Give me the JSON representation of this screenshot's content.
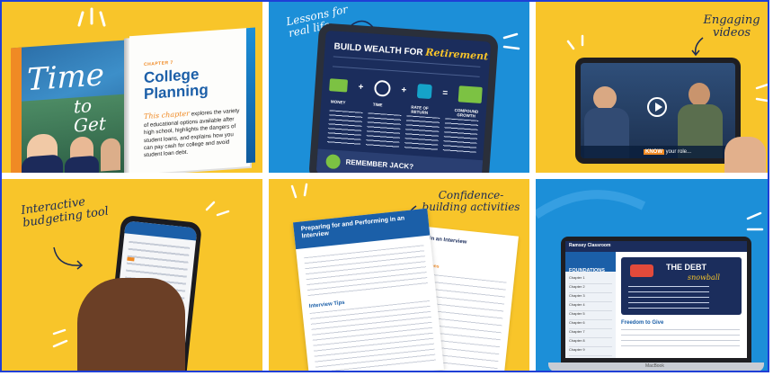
{
  "colors": {
    "yellow": "#f8c52a",
    "blue": "#1c8fd8",
    "navy": "#1b2d5c",
    "orange": "#f08a24",
    "teal": "#15a3c9",
    "green": "#7cc243"
  },
  "panel1": {
    "script_title_1": "Time",
    "script_title_2": "to Get",
    "chapter": "CHAPTER 7",
    "title_line1": "College",
    "title_line2": "Planning",
    "lead": "This chapter",
    "body": "explores the variety of educational options available after high school, highlights the dangers of student loans, and explains how you can pay cash for college and avoid student loan debt."
  },
  "panel2": {
    "annotation": "Lessons for real life",
    "heading": "BUILD WEALTH FOR",
    "heading_script": "Retirement",
    "equation": [
      "MONEY",
      "+",
      "TIME",
      "+",
      "RATE OF RETURN",
      "=",
      "COMPOUND GROWTH"
    ],
    "footer": "REMEMBER JACK?"
  },
  "panel3": {
    "annotation": "Engaging videos",
    "caption_know": "KNOW",
    "caption_rest": "your role..."
  },
  "panel4": {
    "annotation": "Interactive budgeting tool"
  },
  "panel5": {
    "annotation": "Confidence-building activities",
    "doc_title": "Preparing for and Performing in an Interview",
    "back_title": "Performing in an Interview",
    "section1": "Interview Tips",
    "section_label": "Interview Questions"
  },
  "panel6": {
    "brand": "Ramsey Classroom",
    "side_title": "FOUNDATIONS",
    "card_title": "THE DEBT",
    "card_script": "snowball",
    "section_title": "Freedom to Give",
    "laptop_brand": "MacBook",
    "chapters": [
      "Chapter 1",
      "Chapter 2",
      "Chapter 3",
      "Chapter 4",
      "Chapter 5",
      "Chapter 6",
      "Chapter 7",
      "Chapter 8",
      "Chapter 9"
    ]
  }
}
